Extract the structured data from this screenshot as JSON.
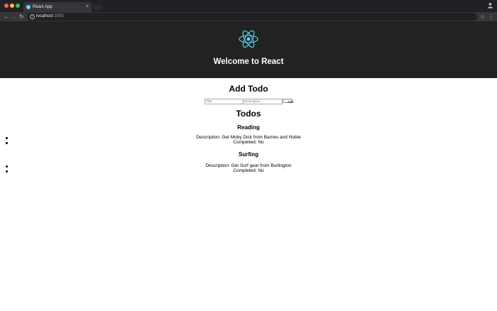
{
  "browser": {
    "tab_title": "React App",
    "tab_close": "×",
    "url_host": "localhost",
    "url_port": ":3000",
    "icons": [
      "close-icon",
      "profile-icon",
      "back-arrow-icon",
      "forward-arrow-icon",
      "reload-icon",
      "info-icon",
      "star-icon",
      "kebab-menu-icon"
    ]
  },
  "header": {
    "title": "Welcome to React",
    "logo_color": "#61dafb",
    "background": "#222222"
  },
  "add_todo": {
    "heading": "Add Todo",
    "title_placeholder": "Title",
    "description_placeholder": "Description",
    "add_label": "Add"
  },
  "todos": {
    "heading": "Todos",
    "items": [
      {
        "name": "Reading",
        "description": "Description: Get Moby Dick from Barnes and Noble",
        "completed": "Completed: No"
      },
      {
        "name": "Surfing",
        "description": "Description: Get Surf gear from Burlington",
        "completed": "Completed: No"
      }
    ]
  }
}
